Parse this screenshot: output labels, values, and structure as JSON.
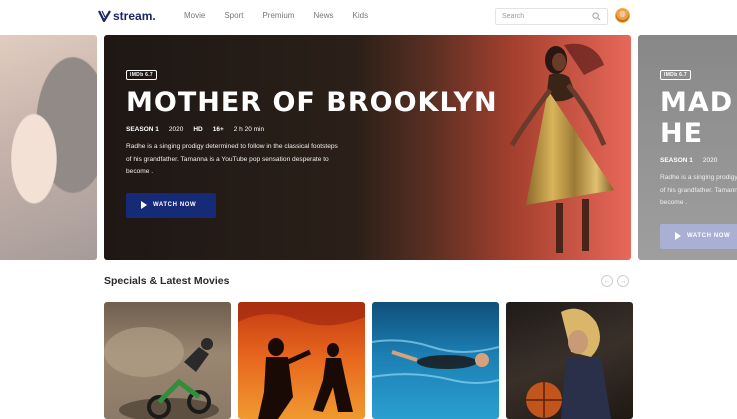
{
  "app": {
    "logo_text": "stream.",
    "brand_color": "#1c2566"
  },
  "nav": {
    "items": [
      "Movie",
      "Sport",
      "Premium",
      "News",
      "Kids"
    ]
  },
  "search": {
    "placeholder": "Search"
  },
  "hero": {
    "badge": "IMDb 6.7",
    "title": "MOTHER OF BROOKLYN",
    "season": "SEASON 1",
    "year": "2020",
    "quality": "HD",
    "rating": "16+",
    "duration": "2 h 20 min",
    "description": "Radhe is a singing prodigy determined to follow in the classical footsteps of his grandfather. Tamanna is a YouTube pop sensation desperate to become .",
    "cta_label": "WATCH NOW",
    "cta_color": "#172a78"
  },
  "hero_next": {
    "badge": "IMDb 6.7",
    "title": "MAD IN HE",
    "season": "SEASON 1",
    "year": "2020",
    "description": "Radhe is a singing prodigy determined to follow in the classical footsteps of his grandfather. Tamanna is a YouTube pop sensation desperate to become .",
    "cta_label": "WATCH NOW"
  },
  "section": {
    "title": "Specials & Latest Movies"
  },
  "icons": {
    "prev": "chevron-left-icon",
    "next": "chevron-right-icon",
    "search": "search-icon",
    "play": "play-icon"
  }
}
